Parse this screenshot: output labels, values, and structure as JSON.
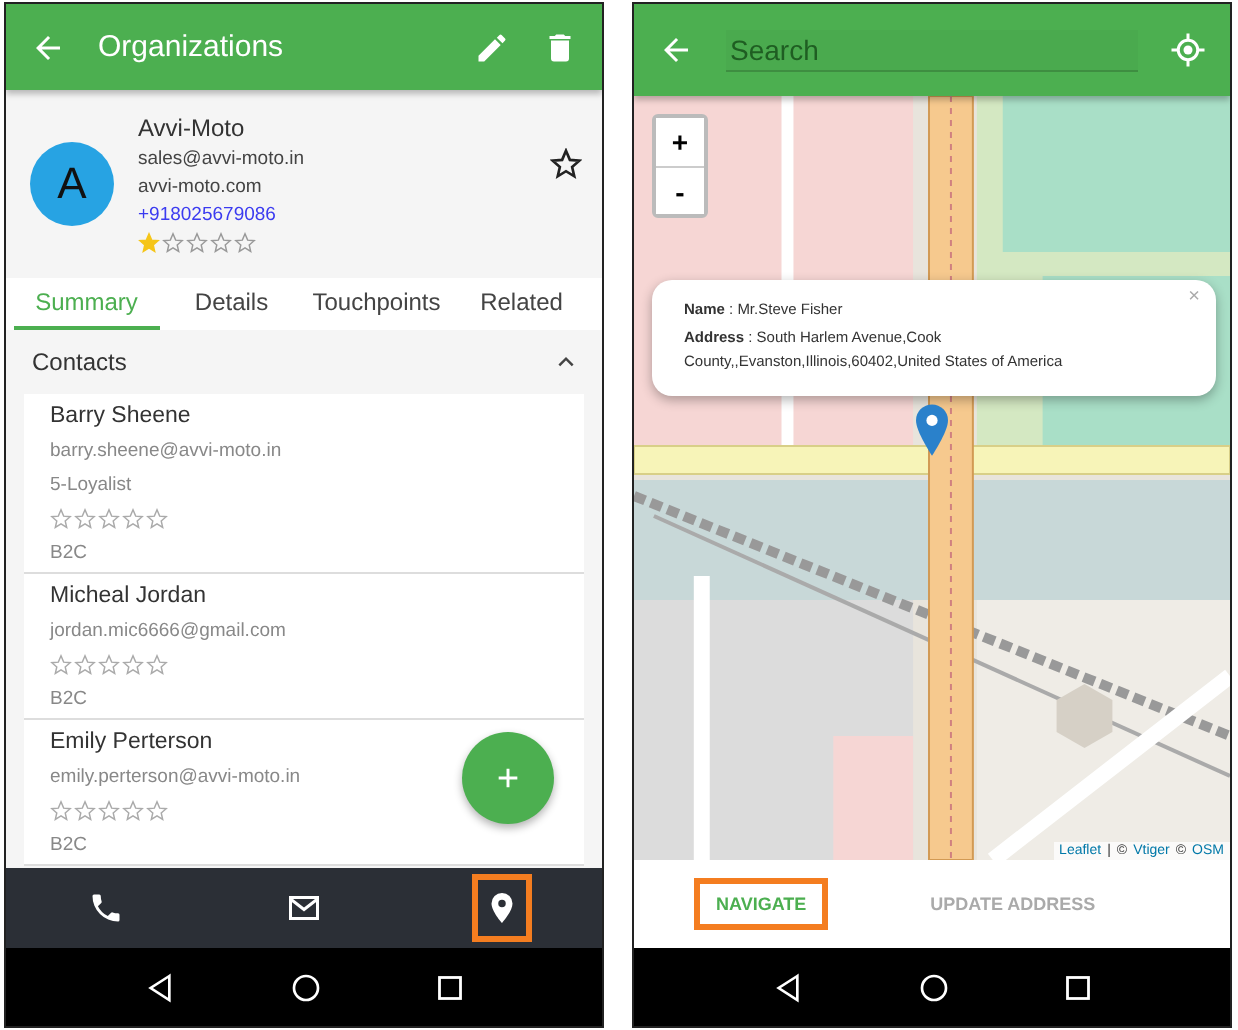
{
  "left_screen": {
    "app_bar": {
      "title": "Organizations"
    },
    "organization": {
      "avatar_letter": "A",
      "name": "Avvi-Moto",
      "email": "sales@avvi-moto.in",
      "website": "avvi-moto.com",
      "phone": "+918025679086",
      "stars": 1,
      "favorite": false
    },
    "tabs": [
      {
        "label": "Summary",
        "selected": true
      },
      {
        "label": "Details",
        "selected": false
      },
      {
        "label": "Touchpoints",
        "selected": false
      },
      {
        "label": "Related",
        "selected": false
      }
    ],
    "contacts_section": {
      "title": "Contacts",
      "expanded": true
    },
    "contacts": [
      {
        "name": "Barry Sheene",
        "email": "barry.sheene@avvi-moto.in",
        "segment": "5-Loyalist",
        "stars": 0,
        "type": "B2C"
      },
      {
        "name": "Micheal Jordan",
        "email": "jordan.mic6666@gmail.com",
        "stars": 0,
        "type": "B2C"
      },
      {
        "name": "Emily Perterson",
        "email": "emily.perterson@avvi-moto.in",
        "stars": 0,
        "type": "B2C"
      }
    ],
    "bottom_nav": [
      {
        "kind": "phone",
        "highlighted": false
      },
      {
        "kind": "mail",
        "highlighted": false
      },
      {
        "kind": "location",
        "highlighted": true
      }
    ]
  },
  "right_screen": {
    "search": {
      "placeholder": "Search"
    },
    "zoom_controls": [
      "+",
      "-"
    ],
    "popup": {
      "name": "**Name** : Mr.Steve Fisher",
      "address": "**Address** : South Harlem Avenue,Cook County,,Evanston,Illinois,60402,United States of America",
      "close": "×"
    },
    "attribution": [
      {
        "text": "Leaflet",
        "link": true
      },
      {
        "text": "|",
        "link": false
      },
      {
        "text": "©",
        "link": false
      },
      {
        "text": "Vtiger",
        "link": true
      },
      {
        "text": "©",
        "link": false
      },
      {
        "text": "OSM",
        "link": true
      }
    ],
    "actions": [
      {
        "label": "NAVIGATE",
        "highlighted": true,
        "disabled": false
      },
      {
        "label": "UPDATE ADDRESS",
        "highlighted": false,
        "disabled": true
      }
    ]
  }
}
